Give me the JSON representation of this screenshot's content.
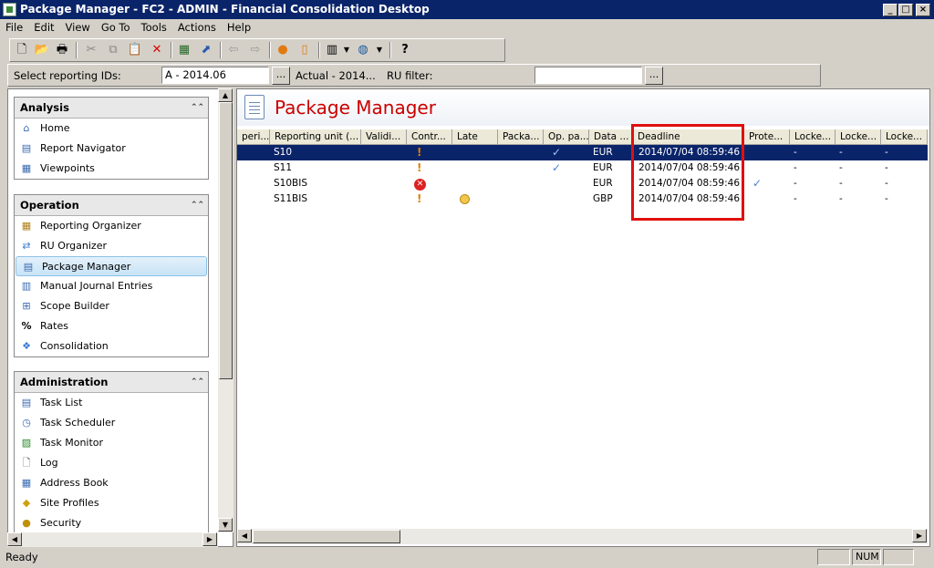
{
  "window": {
    "title": "Package Manager - FC2 - ADMIN - Financial Consolidation Desktop",
    "min": "_",
    "max": "□",
    "close": "×"
  },
  "menu": [
    "File",
    "Edit",
    "View",
    "Go To",
    "Tools",
    "Actions",
    "Help"
  ],
  "reporting_bar": {
    "label": "Select reporting IDs:",
    "reporting_id_value": "A - 2014.06",
    "browse1": "...",
    "actual_text": "Actual - 2014...",
    "ru_filter_label": "RU filter:",
    "ru_filter_value": "",
    "browse2": "..."
  },
  "sidebar": {
    "analysis": {
      "title": "Analysis",
      "items": [
        "Home",
        "Report Navigator",
        "Viewpoints"
      ]
    },
    "operation": {
      "title": "Operation",
      "items": [
        "Reporting Organizer",
        "RU Organizer",
        "Package Manager",
        "Manual Journal Entries",
        "Scope Builder",
        "Rates",
        "Consolidation"
      ]
    },
    "administration": {
      "title": "Administration",
      "items": [
        "Task List",
        "Task Scheduler",
        "Task Monitor",
        "Log",
        "Address Book",
        "Site Profiles",
        "Security"
      ]
    }
  },
  "main": {
    "title": "Package Manager",
    "columns": [
      "peri...",
      "Reporting unit (...",
      "Validi...",
      "Contr...",
      "Late",
      "Packa...",
      "Op. pa...",
      "Data ...",
      "Deadline",
      "Prote...",
      "Locke...",
      "Locke...",
      "Locke..."
    ],
    "rows": [
      {
        "unit": "S10",
        "control": "!",
        "late": "",
        "op": "✓",
        "data": "EUR",
        "deadline": "2014/07/04 08:59:46",
        "prot": "",
        "l1": "-",
        "l2": "-",
        "l3": "-"
      },
      {
        "unit": "S11",
        "control": "!",
        "late": "",
        "op": "✓",
        "data": "EUR",
        "deadline": "2014/07/04 08:59:46",
        "prot": "",
        "l1": "-",
        "l2": "-",
        "l3": "-"
      },
      {
        "unit": "S10BIS",
        "control": "✕",
        "late": "",
        "op": "",
        "data": "EUR",
        "deadline": "2014/07/04 08:59:46",
        "prot": "✓",
        "l1": "-",
        "l2": "-",
        "l3": "-"
      },
      {
        "unit": "S11BIS",
        "control": "!",
        "late": "◷",
        "op": "",
        "data": "GBP",
        "deadline": "2014/07/04 08:59:46",
        "prot": "",
        "l1": "-",
        "l2": "-",
        "l3": "-"
      }
    ]
  },
  "status": {
    "text": "Ready",
    "num": "NUM"
  },
  "icons": [
    "new-icon",
    "open-icon",
    "print-icon",
    "cut-icon",
    "copy-icon",
    "paste-icon",
    "delete-icon",
    "report-icon",
    "export-icon",
    "back-icon",
    "forward-icon",
    "user-icon",
    "book-icon",
    "grid-icon",
    "globe-icon",
    "help-icon"
  ],
  "colors": {
    "title_bar": "#0a246a",
    "selection": "#0a246a",
    "header_title": "#cc0000",
    "highlight_box": "#e01010"
  }
}
